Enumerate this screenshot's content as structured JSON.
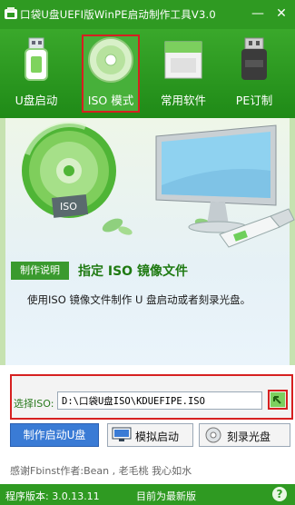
{
  "window": {
    "title": "口袋U盘UEFI版WinPE启动制作工具V3.0",
    "minimize_glyph": "—",
    "close_glyph": "✕"
  },
  "toolbar": {
    "tabs": [
      {
        "label": "U盘启动",
        "icon": "usb-drive-icon",
        "active": false
      },
      {
        "label": "ISO 模式",
        "icon": "disc-icon",
        "active": true
      },
      {
        "label": "常用软件",
        "icon": "software-box-icon",
        "active": false
      },
      {
        "label": "PE订制",
        "icon": "usb-flash-8gb-icon",
        "active": false
      }
    ]
  },
  "banner": {
    "disc_text": "ISO",
    "badge": "制作说明",
    "heading": "指定 ISO 镜像文件",
    "description": "使用ISO 镜像文件制作 U 盘启动或者刻录光盘。"
  },
  "iso_select": {
    "label": "选择ISO:",
    "path": "D:\\口袋U盘ISO\\KDUEFIPE.ISO"
  },
  "actions": {
    "make": "制作启动U盘",
    "simulate": "模拟启动",
    "burn": "刻录光盘"
  },
  "credits": "感谢Fbinst作者:Bean , 老毛桃 我心如水",
  "statusbar": {
    "version": "程序版本: 3.0.13.11",
    "status": "目前为最新版",
    "help": "?"
  },
  "colors": {
    "brand_green": "#2f9a22",
    "highlight_red": "#d62020",
    "primary_blue": "#3a7bd5"
  }
}
